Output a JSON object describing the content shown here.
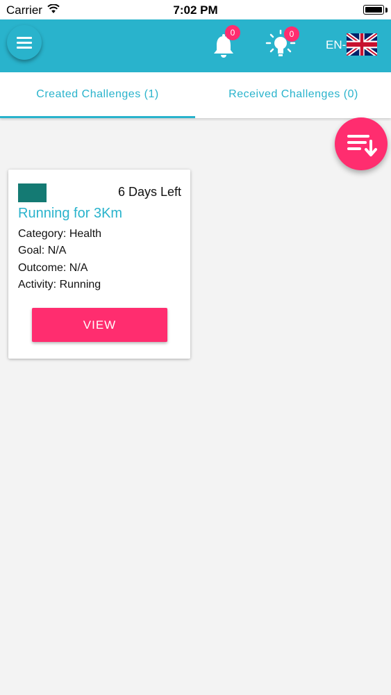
{
  "status_bar": {
    "carrier": "Carrier",
    "time": "7:02 PM"
  },
  "app_bar": {
    "notifications_count": "0",
    "tips_count": "0",
    "language_label": "EN-"
  },
  "tabs": [
    {
      "label": "Created Challenges (1)",
      "active": true
    },
    {
      "label": "Received Challenges (0)",
      "active": false
    }
  ],
  "challenges": [
    {
      "days_left": "6 Days Left",
      "title": "Running for 3Km",
      "category": "Category: Health",
      "goal": "Goal: N/A",
      "outcome": "Outcome: N/A",
      "activity": "Activity: Running",
      "view_label": "VIEW"
    }
  ],
  "colors": {
    "primary": "#29b3cc",
    "accent": "#ff2d6f",
    "thumbnail": "#147a73",
    "background": "#f3f3f3"
  },
  "icons": {
    "menu": "hamburger-icon",
    "notifications": "bell-icon",
    "tips": "lightbulb-icon",
    "language": "uk-flag-icon",
    "sort": "sort-descending-icon"
  }
}
